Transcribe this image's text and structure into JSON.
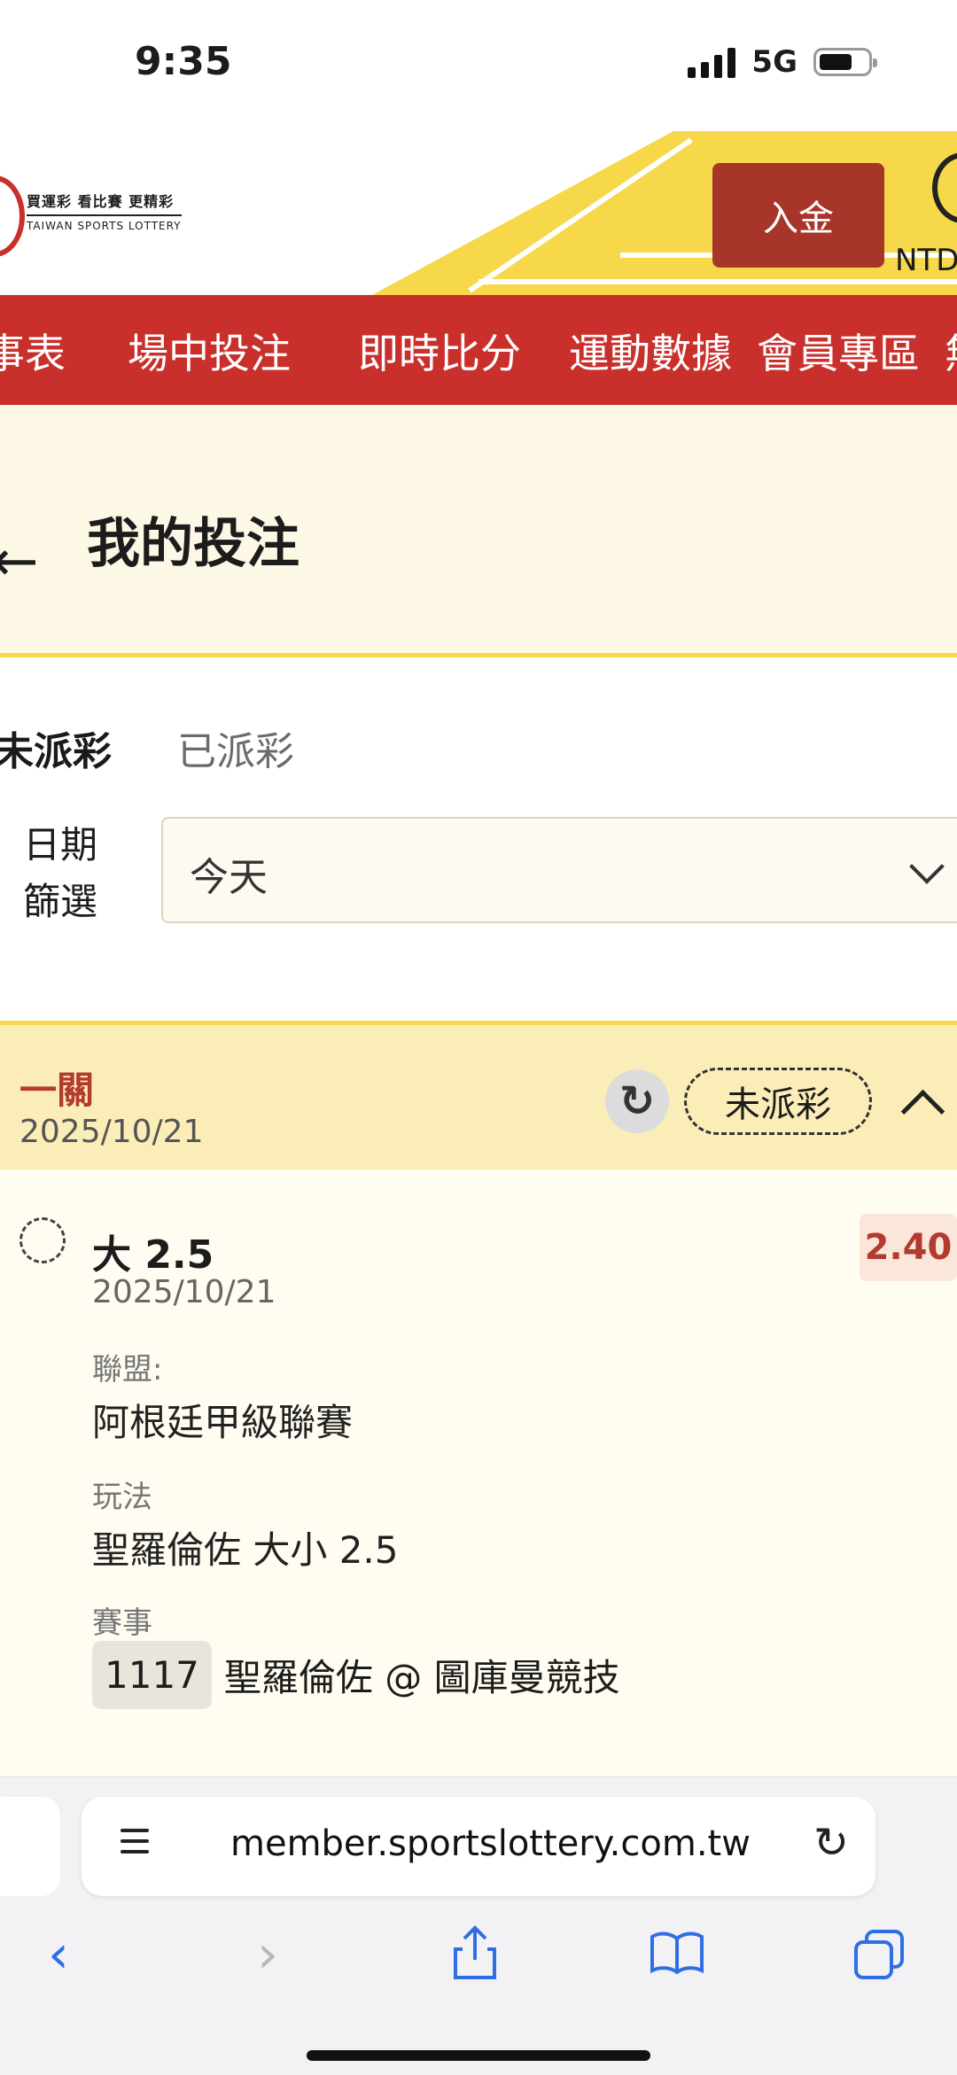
{
  "status_bar": {
    "time": "9:35",
    "network": "5G"
  },
  "header": {
    "logo_zh": "買運彩 看比賽 更精彩",
    "logo_en": "TAIWAN SPORTS LOTTERY",
    "deposit_label": "入金",
    "currency": "NTD"
  },
  "nav": {
    "items": [
      "事表",
      "場中投注",
      "即時比分",
      "運動數據",
      "會員專區",
      "無"
    ]
  },
  "page": {
    "back_icon": "back-arrow-icon",
    "title": "我的投注"
  },
  "tabs": {
    "active": "未派彩",
    "inactive": "已派彩"
  },
  "filter": {
    "label": "日期篩選",
    "value": "今天"
  },
  "bet": {
    "type": "一關",
    "date": "2025/10/21",
    "status": "未派彩",
    "selection": "大 2.5",
    "selection_date": "2025/10/21",
    "odds": "2.40",
    "league_label": "聯盟:",
    "league": "阿根廷甲級聯賽",
    "market_label": "玩法",
    "market": "聖羅倫佐 大小 2.5",
    "event_label": "賽事",
    "event_code": "1117",
    "event_name": "聖羅倫佐 @ 圖庫曼競技"
  },
  "browser": {
    "url": "member.sportslottery.com.tw"
  },
  "colors": {
    "brand_red": "#c9302c",
    "accent_yellow": "#f6d84a",
    "odds_red": "#b23a2e"
  }
}
